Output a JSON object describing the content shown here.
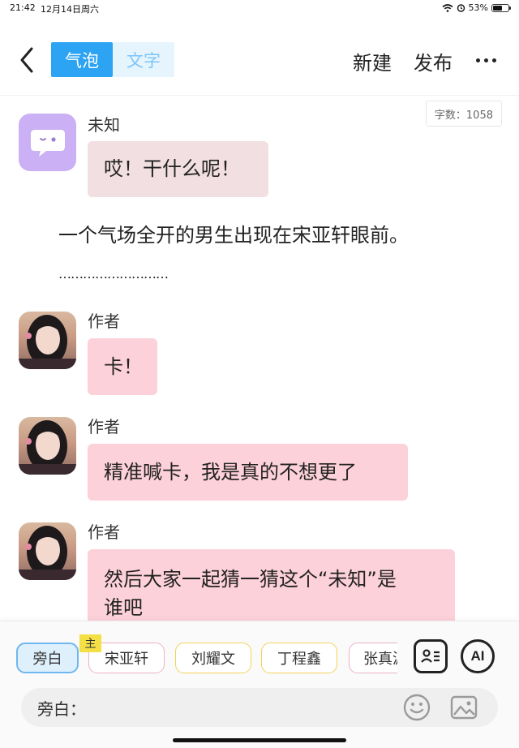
{
  "status": {
    "time": "21:42",
    "date": "12月14日周六",
    "battery": "53%"
  },
  "header": {
    "tabs": [
      {
        "label": "气泡",
        "active": true
      },
      {
        "label": "文字",
        "active": false
      }
    ],
    "new_label": "新建",
    "publish_label": "发布"
  },
  "word_count": "字数：1058",
  "messages": [
    {
      "name": "未知",
      "text": "哎！干什么呢！"
    },
    {
      "narration": "一个气场全开的男生出现在宋亚轩眼前。",
      "dots": "………………………"
    },
    {
      "name": "作者",
      "text": "卡！"
    },
    {
      "name": "作者",
      "text": "精准喊卡，我是真的不想更了"
    },
    {
      "name": "作者",
      "text_line1": "然后大家一起猜一猜这个“未知”是",
      "text_line2": "谁吧"
    }
  ],
  "characters": {
    "main_badge": "主",
    "chips": [
      "旁白",
      "宋亚轩",
      "刘耀文",
      "丁程鑫",
      "张真源"
    ],
    "selected": "旁白",
    "chip_border_colors": [
      "#6fb7ee",
      "#e9b3c3",
      "#f1d35a",
      "#f1d35a",
      "#e9b3c3"
    ]
  },
  "input": {
    "prefix": "旁白："
  },
  "icons": [
    "back-arrow-icon",
    "more-icon",
    "character-card-icon",
    "ai-icon",
    "emoji-icon",
    "image-icon",
    "wifi-icon",
    "alarm-icon",
    "battery-icon"
  ],
  "colors": {
    "accent": "#2ca3f3",
    "bubble_author": "#fdd1da",
    "bubble_unknown": "#f2dfe1",
    "avatar_unknown": "#cbb0f5"
  }
}
